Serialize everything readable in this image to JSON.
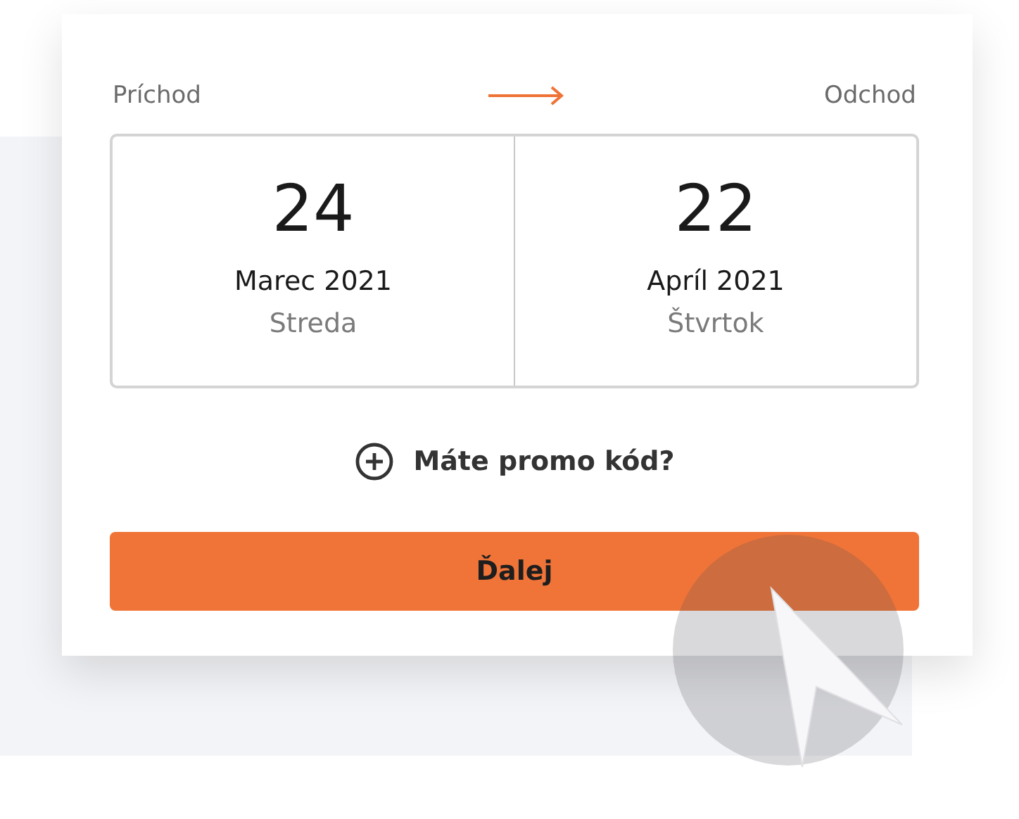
{
  "labels": {
    "arrival": "Príchod",
    "departure": "Odchod"
  },
  "dates": [
    {
      "day": "24",
      "month_year": "Marec 2021",
      "weekday": "Streda"
    },
    {
      "day": "22",
      "month_year": "Apríl 2021",
      "weekday": "Štvrtok"
    }
  ],
  "promo": {
    "label": "Máte promo kód?"
  },
  "button": {
    "label": "Ďalej"
  }
}
